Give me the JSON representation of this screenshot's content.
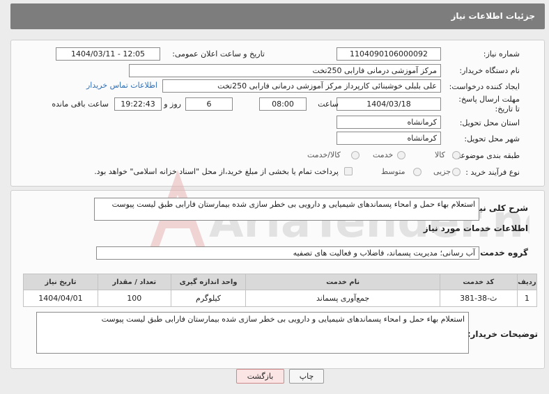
{
  "header": {
    "title": "جزئیات اطلاعات نیاز"
  },
  "form": {
    "need_number_label": "شماره نیاز:",
    "need_number": "1104090106000092",
    "announce_label": "تاریخ و ساعت اعلان عمومی:",
    "announce_value": "1404/03/11 - 12:05",
    "buyer_org_label": "نام دستگاه خریدار:",
    "buyer_org": "مرکز آموزشی  درمانی فارابی 250تخت",
    "requester_label": "ایجاد کننده درخواست:",
    "requester": "علی بلبلی خوشبنائی کارپرداز مرکز آموزشی  درمانی فارابی 250تخت",
    "contact_link": "اطلاعات تماس خریدار",
    "deadline_label": "مهلت ارسال پاسخ: تا تاریخ:",
    "deadline_date": "1404/03/18",
    "time_label": "ساعت",
    "deadline_time": "08:00",
    "days_value": "6",
    "days_label": "روز و",
    "remaining_time": "19:22:43",
    "remaining_label": "ساعت باقی مانده",
    "province_label": "استان محل تحویل:",
    "province": "کرمانشاه",
    "city_label": "شهر محل تحویل:",
    "city": "کرمانشاه",
    "category_label": "طبقه بندی موضوعی:",
    "category_options": [
      "کالا",
      "خدمت",
      "کالا/خدمت"
    ],
    "process_label": "نوع فرآیند خرید :",
    "process_options": [
      "جزیی",
      "متوسط"
    ],
    "payment_note": "پرداخت تمام یا بخشی از مبلغ خرید،از محل \"اسناد خزانه اسلامی\" خواهد بود."
  },
  "description": {
    "label": "شرح کلی نیاز:",
    "value": "استعلام بهاء حمل و امحاء پسماندهای شیمیایی و دارویی بی خطر سازی شده بیمارستان فارابی طبق لیست پیوست"
  },
  "services": {
    "section_title": "اطلاعات خدمات مورد نیاز",
    "group_label": "گروه خدمت:",
    "group_value": "آب رسانی؛ مدیریت پسماند، فاضلاب و فعالیت های تصفیه",
    "columns": [
      "ردیف",
      "کد خدمت",
      "نام خدمت",
      "واحد اندازه گیری",
      "تعداد / مقدار",
      "تاریخ نیاز"
    ],
    "rows": [
      {
        "row": "1",
        "code": "ث-38-381",
        "name": "جمع‌آوری پسماند",
        "unit": "کیلوگرم",
        "qty": "100",
        "date": "1404/04/01"
      }
    ]
  },
  "buyer_notes": {
    "label": "توضیحات خریدار:",
    "value": "استعلام بهاء حمل و امحاء پسماندهای شیمیایی و دارویی بی خطر سازی شده بیمارستان فارابی طبق لیست پیوست"
  },
  "buttons": {
    "print": "چاپ",
    "back": "بازگشت"
  },
  "watermark": {
    "text": "AriaTender.neT"
  }
}
